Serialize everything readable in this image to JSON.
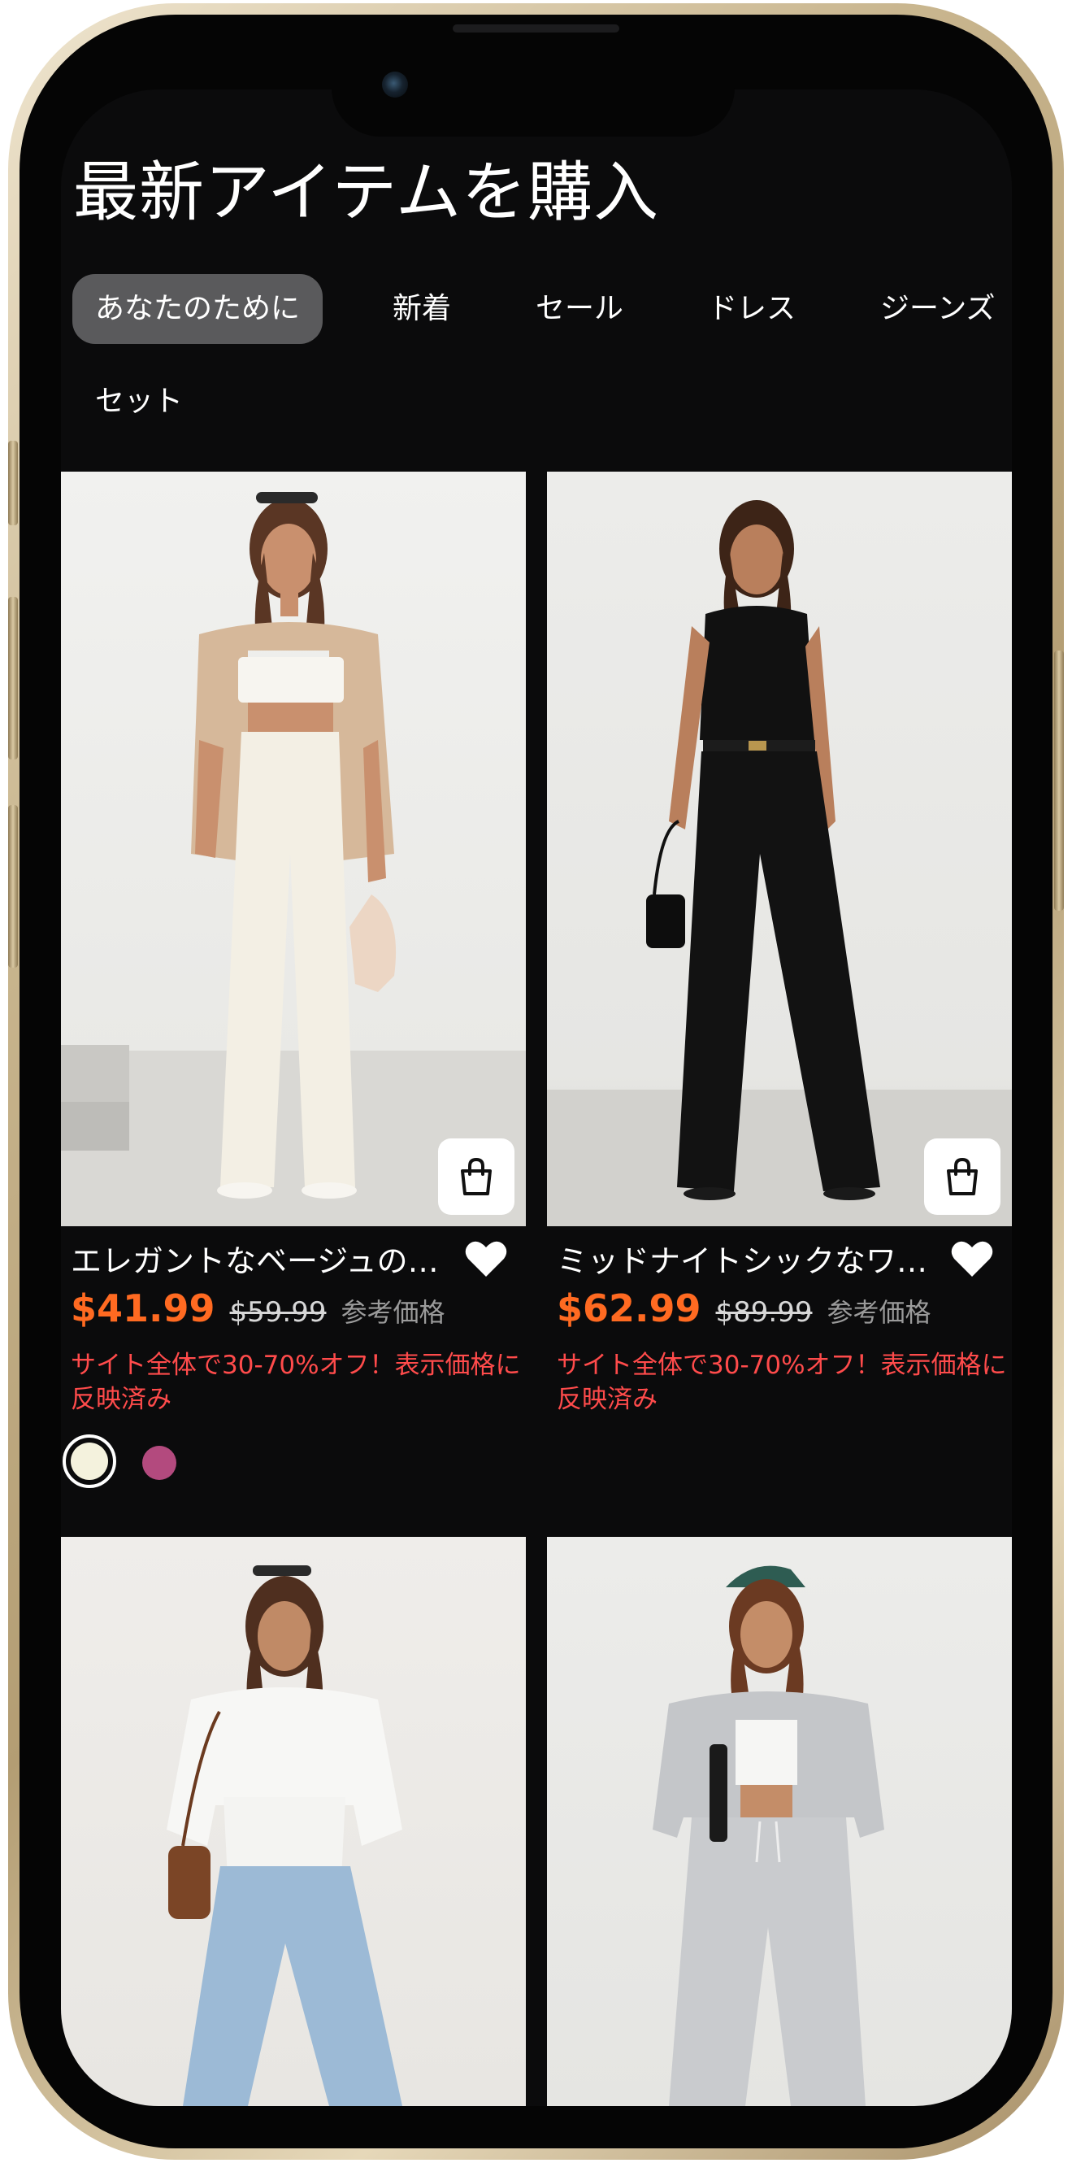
{
  "page_title": "最新アイテムを購入",
  "tabs": [
    {
      "label": "あなたのために",
      "active": true
    },
    {
      "label": "新着",
      "active": false
    },
    {
      "label": "セール",
      "active": false
    },
    {
      "label": "ドレス",
      "active": false
    },
    {
      "label": "ジーンズ",
      "active": false
    },
    {
      "label": "セット",
      "active": false
    }
  ],
  "products": [
    {
      "name": "エレガントなベージュの…",
      "price": "$41.99",
      "old_price": "$59.99",
      "ref_label": "参考価格",
      "promo": "サイト全体で30-70%オフ！表示価格に反映済み",
      "swatches": [
        "#f4f2dd",
        "#b34a7e"
      ]
    },
    {
      "name": "ミッドナイトシックなワ…",
      "price": "$62.99",
      "old_price": "$89.99",
      "ref_label": "参考価格",
      "promo": "サイト全体で30-70%オフ！表示価格に反映済み",
      "swatches": []
    },
    {
      "name": "",
      "price": "",
      "old_price": "",
      "ref_label": "",
      "promo": ""
    },
    {
      "name": "",
      "price": "",
      "old_price": "",
      "ref_label": "",
      "promo": ""
    }
  ],
  "colors": {
    "background": "#0b0b0c",
    "price": "#ff6a21",
    "promo": "#ff4b4b",
    "active_tab": "#5a5a5c"
  },
  "icons": [
    "shopping-bag-icon",
    "heart-icon"
  ]
}
